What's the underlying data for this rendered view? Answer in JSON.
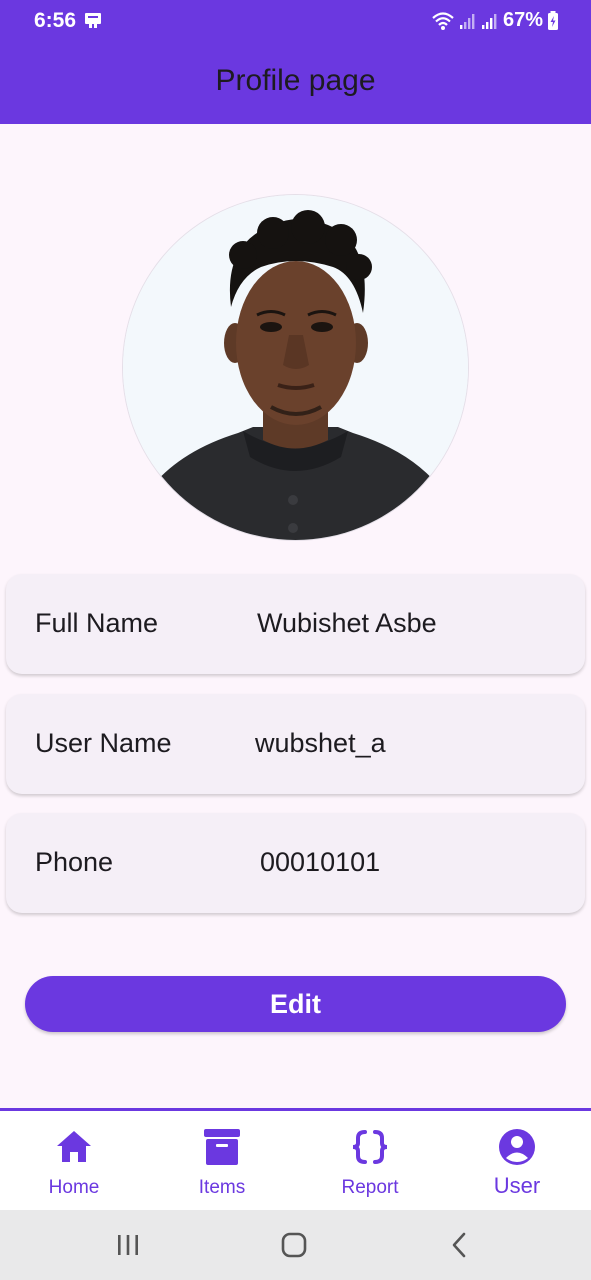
{
  "status_bar": {
    "time": "6:56",
    "battery": "67%"
  },
  "app_bar": {
    "title": "Profile page"
  },
  "profile": {
    "fields": [
      {
        "label": "Full Name",
        "value": "Wubishet Asbe"
      },
      {
        "label": "User Name",
        "value": "wubshet_a"
      },
      {
        "label": "Phone",
        "value": "00010101"
      }
    ]
  },
  "edit_button": {
    "label": "Edit"
  },
  "bottom_nav": {
    "items": [
      {
        "label": "Home",
        "icon": "home-icon"
      },
      {
        "label": "Items",
        "icon": "archive-icon"
      },
      {
        "label": "Report",
        "icon": "braces-icon"
      },
      {
        "label": "User",
        "icon": "account-circle-icon"
      }
    ],
    "selected": "User"
  },
  "colors": {
    "primary": "#6b38e0",
    "background": "#fdf5fc",
    "card": "#f5eff7",
    "text": "#1d1b20"
  }
}
